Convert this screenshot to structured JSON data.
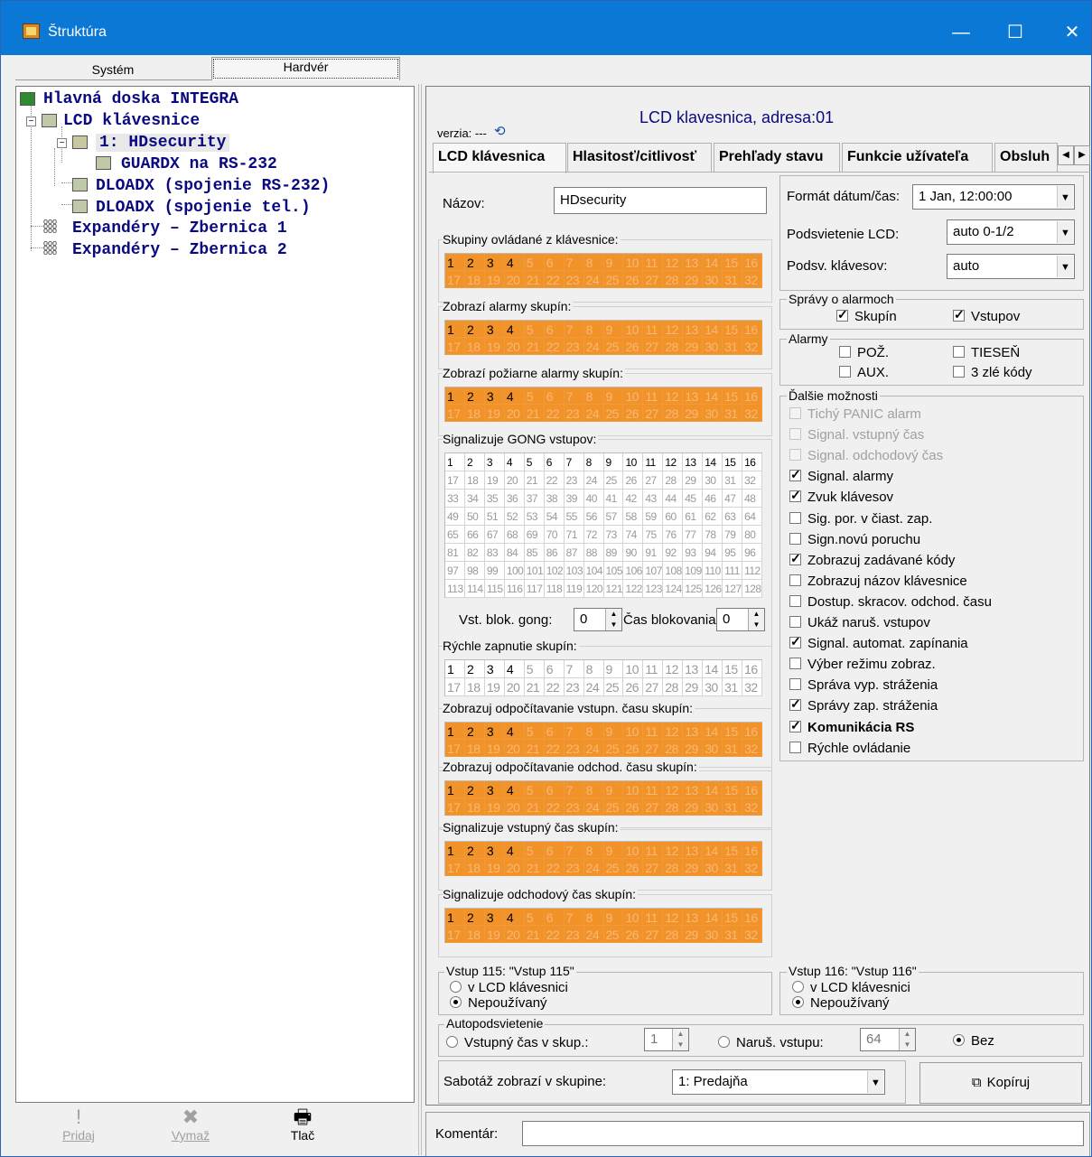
{
  "window": {
    "title": "Štruktúra",
    "min": "—",
    "max": "☐",
    "close": "✕"
  },
  "left_tabs": [
    "Systém",
    "Hardvér"
  ],
  "tree": {
    "root": "Hlavná doska INTEGRA",
    "lcd": "LCD klávesnice",
    "hdsec": "1: HDsecurity",
    "guardx": "GUARDX na RS-232",
    "dloadx1": "DLOADX (spojenie RS-232)",
    "dloadx2": "DLOADX (spojenie tel.)",
    "exp1": "Expandéry – Zbernica 1",
    "exp2": "Expandéry – Zbernica 2"
  },
  "bottom_left": {
    "add": "Pridaj",
    "delete": "Vymaž",
    "print": "Tlač"
  },
  "header": {
    "title": "LCD klavesnica, adresa:01",
    "version": "verzia: ---"
  },
  "tabs": [
    "LCD klávesnica",
    "Hlasitosť/citlivosť",
    "Prehľady stavu",
    "Funkcie užívateľa",
    "Obsluh"
  ],
  "name": {
    "label": "Názov:",
    "value": "HDsecurity"
  },
  "grids": {
    "controlled": {
      "label": "Skupiny ovládané z klávesnice:",
      "active": [
        1,
        2,
        3,
        4
      ]
    },
    "alarms": {
      "label": "Zobrazí alarmy skupín:",
      "active": [
        1,
        2,
        3,
        4
      ]
    },
    "fire": {
      "label": "Zobrazí požiarne alarmy skupín:",
      "active": [
        1,
        2,
        3,
        4
      ]
    },
    "gong": {
      "label": "Signalizuje GONG vstupov:",
      "active": [
        1,
        2,
        3,
        4,
        5,
        6,
        7,
        8,
        9,
        10,
        11,
        12,
        13,
        14,
        15,
        16
      ]
    },
    "quick": {
      "label": "Rýchle zapnutie skupín:",
      "active": [
        1,
        2,
        3,
        4
      ]
    },
    "entry_cd": {
      "label": "Zobrazuj odpočítavanie vstupn. času skupín:",
      "active": [
        1,
        2,
        3,
        4
      ]
    },
    "exit_cd": {
      "label": "Zobrazuj odpočítavanie odchod. času skupín:",
      "active": [
        1,
        2,
        3,
        4
      ]
    },
    "entry": {
      "label": "Signalizuje vstupný čas skupín:",
      "active": [
        1,
        2,
        3,
        4
      ]
    },
    "exit": {
      "label": "Signalizuje odchodový čas skupín:",
      "active": [
        1,
        2,
        3,
        4
      ]
    }
  },
  "gong_block": {
    "label": "Vst. blok. gong:",
    "value": "0",
    "time_label": "Čas blokovania",
    "time_value": "0"
  },
  "date_format": {
    "label": "Formát dátum/čas:",
    "value": "1 Jan, 12:00:00"
  },
  "lcd_backlight": {
    "label": "Podsvietenie LCD:",
    "value": "auto 0-1/2"
  },
  "key_backlight": {
    "label": "Podsv. klávesov:",
    "value": "auto"
  },
  "alarm_msgs": {
    "title": "Správy o alarmoch",
    "groups": "Skupín",
    "inputs": "Vstupov",
    "groups_checked": true,
    "inputs_checked": true
  },
  "alarms": {
    "title": "Alarmy",
    "fire": "POŽ.",
    "panic": "TIESEŇ",
    "aux": "AUX.",
    "bad_codes": "3 zlé kódy"
  },
  "options": {
    "title": "Ďalšie možnosti",
    "items": [
      {
        "label": "Tichý PANIC alarm",
        "checked": false,
        "disabled": true
      },
      {
        "label": "Signal. vstupný čas",
        "checked": false,
        "disabled": true
      },
      {
        "label": "Signal. odchodový čas",
        "checked": false,
        "disabled": true
      },
      {
        "label": "Signal. alarmy",
        "checked": true,
        "disabled": false
      },
      {
        "label": "Zvuk klávesov",
        "checked": true,
        "disabled": false
      },
      {
        "label": "Sig. por. v čiast. zap.",
        "checked": false,
        "disabled": false
      },
      {
        "label": "Sign.novú poruchu",
        "checked": false,
        "disabled": false
      },
      {
        "label": "Zobrazuj zadávané kódy",
        "checked": true,
        "disabled": false
      },
      {
        "label": "Zobrazuj názov klávesnice",
        "checked": false,
        "disabled": false
      },
      {
        "label": "Dostup. skracov. odchod. času",
        "checked": false,
        "disabled": false
      },
      {
        "label": "Ukáž naruš. vstupov",
        "checked": false,
        "disabled": false
      },
      {
        "label": "Signal. automat. zapínania",
        "checked": true,
        "disabled": false
      },
      {
        "label": "Výber režimu zobraz.",
        "checked": false,
        "disabled": false
      },
      {
        "label": "Správa vyp. stráženia",
        "checked": false,
        "disabled": false
      },
      {
        "label": "Správy zap. stráženia",
        "checked": true,
        "disabled": false
      },
      {
        "label": "Komunikácia RS",
        "checked": true,
        "disabled": false,
        "bold": true
      },
      {
        "label": "Rýchle ovládanie",
        "checked": false,
        "disabled": false
      }
    ]
  },
  "input115": {
    "title": "Vstup 115: \"Vstup 115\"",
    "opt1": "v LCD klávesnici",
    "opt2": "Nepoužívaný"
  },
  "input116": {
    "title": "Vstup 116: \"Vstup 116\"",
    "opt1": "v LCD klávesnici",
    "opt2": "Nepoužívaný"
  },
  "autobacklight": {
    "title": "Autopodsvietenie",
    "entry": "Vstupný čas v skup.:",
    "entry_value": "1",
    "violation": "Naruš. vstupu:",
    "violation_value": "64",
    "none": "Bez"
  },
  "tamper": {
    "label": "Sabotáž zobrazí v skupine:",
    "value": "1: Predajňa"
  },
  "copy": "Kopíruj",
  "comment": {
    "label": "Komentár:",
    "value": ""
  }
}
